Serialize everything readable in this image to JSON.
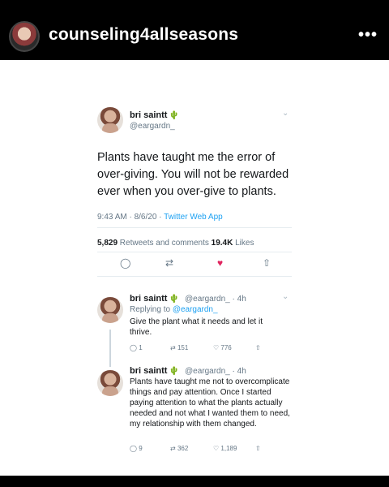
{
  "instagram": {
    "username": "counseling4allseasons",
    "more_label": "•••"
  },
  "tweet": {
    "display_name": "bri saintt",
    "emoji": "🌵",
    "handle": "@eargardn_",
    "text": "Plants have taught me the error of over-giving. You will not be rewarded ever when you over-give to plants.",
    "timestamp": "9:43 AM · 8/6/20 · ",
    "source": "Twitter Web App",
    "retweets_count": "5,829",
    "retweets_label": " Retweets and comments  ",
    "likes_count": "19.4K",
    "likes_label": " Likes"
  },
  "replies": [
    {
      "display_name": "bri saintt",
      "emoji": "🌵",
      "handle_time": "@eargardn_ · 4h",
      "replying_prefix": "Replying to ",
      "replying_handle": "@eargardn_",
      "text": "Give the plant what it needs and let it thrive.",
      "reply_count": "1",
      "retweet_count": "151",
      "like_count": "776"
    },
    {
      "display_name": "bri saintt",
      "emoji": "🌵",
      "handle_time": "@eargardn_ · 4h",
      "text": "Plants have taught me not to overcomplicate things and pay attention. Once I started paying attention to what the plants actually needed and not what I wanted them to need, my relationship with them changed.",
      "reply_count": "9",
      "retweet_count": "362",
      "like_count": "1,189"
    }
  ]
}
